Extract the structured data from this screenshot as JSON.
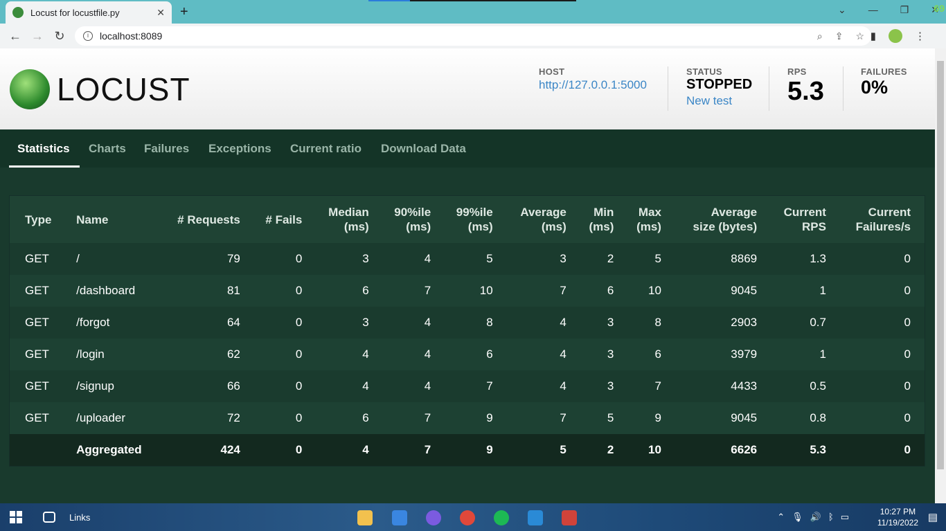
{
  "browser": {
    "tab_title": "Locust for locustfile.py",
    "url": "localhost:8089",
    "corner_number": "69"
  },
  "header": {
    "logo_text": "LOCUST",
    "host_label": "HOST",
    "host_value": "http://127.0.0.1:5000",
    "status_label": "STATUS",
    "status_value": "STOPPED",
    "new_test": "New test",
    "rps_label": "RPS",
    "rps_value": "5.3",
    "failures_label": "FAILURES",
    "failures_value": "0%"
  },
  "tabs": [
    "Statistics",
    "Charts",
    "Failures",
    "Exceptions",
    "Current ratio",
    "Download Data"
  ],
  "table": {
    "headers": [
      [
        "Type"
      ],
      [
        "Name"
      ],
      [
        "# Requests"
      ],
      [
        "# Fails"
      ],
      [
        "Median",
        "(ms)"
      ],
      [
        "90%ile",
        "(ms)"
      ],
      [
        "99%ile",
        "(ms)"
      ],
      [
        "Average",
        "(ms)"
      ],
      [
        "Min",
        "(ms)"
      ],
      [
        "Max",
        "(ms)"
      ],
      [
        "Average",
        "size (bytes)"
      ],
      [
        "Current",
        "RPS"
      ],
      [
        "Current",
        "Failures/s"
      ]
    ],
    "rows": [
      [
        "GET",
        "/",
        "79",
        "0",
        "3",
        "4",
        "5",
        "3",
        "2",
        "5",
        "8869",
        "1.3",
        "0"
      ],
      [
        "GET",
        "/dashboard",
        "81",
        "0",
        "6",
        "7",
        "10",
        "7",
        "6",
        "10",
        "9045",
        "1",
        "0"
      ],
      [
        "GET",
        "/forgot",
        "64",
        "0",
        "3",
        "4",
        "8",
        "4",
        "3",
        "8",
        "2903",
        "0.7",
        "0"
      ],
      [
        "GET",
        "/login",
        "62",
        "0",
        "4",
        "4",
        "6",
        "4",
        "3",
        "6",
        "3979",
        "1",
        "0"
      ],
      [
        "GET",
        "/signup",
        "66",
        "0",
        "4",
        "4",
        "7",
        "4",
        "3",
        "7",
        "4433",
        "0.5",
        "0"
      ],
      [
        "GET",
        "/uploader",
        "72",
        "0",
        "6",
        "7",
        "9",
        "7",
        "5",
        "9",
        "9045",
        "0.8",
        "0"
      ]
    ],
    "aggregated": [
      "",
      "Aggregated",
      "424",
      "0",
      "4",
      "7",
      "9",
      "5",
      "2",
      "10",
      "6626",
      "5.3",
      "0"
    ]
  },
  "taskbar": {
    "links_label": "Links",
    "time": "10:27 PM",
    "date": "11/19/2022"
  }
}
